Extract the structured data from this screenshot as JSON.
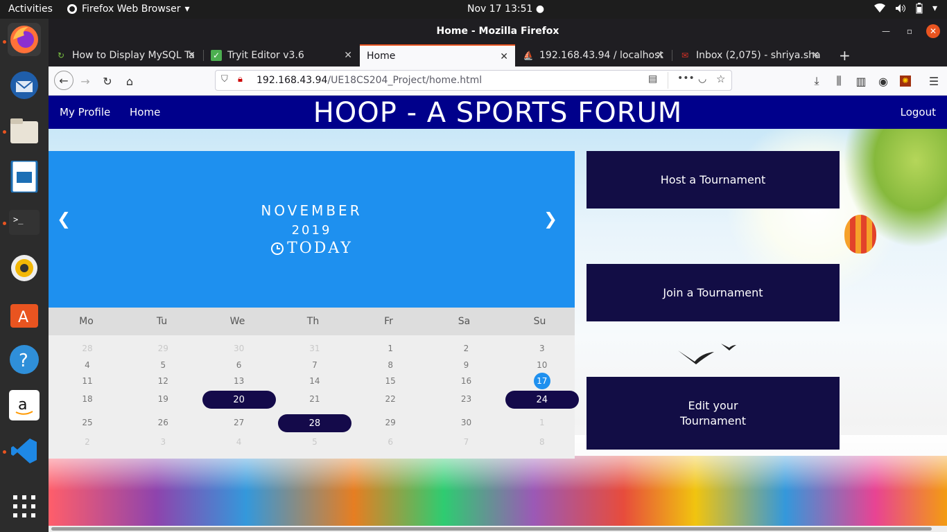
{
  "system": {
    "activities": "Activities",
    "app_menu": "Firefox Web Browser",
    "clock": "Nov 17  13:51"
  },
  "dock": {
    "items": [
      "firefox-icon",
      "thunderbird-icon",
      "files-icon",
      "writer-icon",
      "terminal-icon",
      "rhythmbox-icon",
      "software-icon",
      "help-icon",
      "amazon-icon",
      "vscode-icon",
      "app-grid-icon"
    ]
  },
  "browser": {
    "window_title": "Home - Mozilla Firefox",
    "tabs": [
      {
        "label": "How to Display MySQL Ta",
        "active": false
      },
      {
        "label": "Tryit Editor v3.6",
        "active": false
      },
      {
        "label": "Home",
        "active": true
      },
      {
        "label": "192.168.43.94 / localhost",
        "active": false
      },
      {
        "label": "Inbox (2,075) - shriya.sha",
        "active": false
      }
    ],
    "url_host": "192.168.43.94",
    "url_path": "/UE18CS204_Project/home.html"
  },
  "site": {
    "title": "HOOP - A SPORTS FORUM",
    "nav": {
      "profile": "My Profile",
      "home": "Home",
      "logout": "Logout"
    }
  },
  "calendar": {
    "month": "NOVEMBER",
    "year": "2019",
    "today_label": "TODAY",
    "prev": "❮",
    "next": "❯",
    "weekdays": [
      "Mo",
      "Tu",
      "We",
      "Th",
      "Fr",
      "Sa",
      "Su"
    ],
    "weeks": [
      [
        "28",
        "29",
        "30",
        "31",
        "1",
        "2",
        "3"
      ],
      [
        "4",
        "5",
        "6",
        "7",
        "8",
        "9",
        "10"
      ],
      [
        "11",
        "12",
        "13",
        "14",
        "15",
        "16",
        "17"
      ],
      [
        "18",
        "19",
        "20",
        "21",
        "22",
        "23",
        "24"
      ],
      [
        "25",
        "26",
        "27",
        "28",
        "29",
        "30",
        "1"
      ],
      [
        "2",
        "3",
        "4",
        "5",
        "6",
        "7",
        "8"
      ]
    ],
    "today": "17",
    "event_days": [
      "20",
      "24",
      "28"
    ]
  },
  "actions": {
    "host": "Host a Tournament",
    "join": "Join a Tournament",
    "edit": "Edit your\nTournament"
  }
}
